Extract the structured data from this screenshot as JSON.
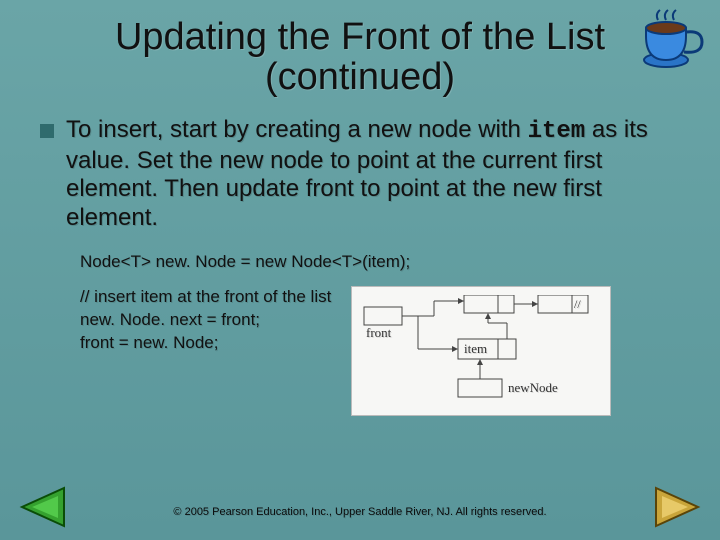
{
  "title": "Updating the Front of the List (continued)",
  "bullet_text_pre": "To insert, start by creating a new node with ",
  "bullet_text_mono": "item",
  "bullet_text_post": " as its value.  Set the new node to point at the current first element.  Then update front to point at the new first element.",
  "code": {
    "line1": "Node<T> new. Node = new Node<T>(item);",
    "comment": "// insert item at the front of the list",
    "line2": "new. Node. next = front;",
    "line3": "front = new. Node;"
  },
  "diagram": {
    "front_label": "front",
    "item_label": "item",
    "newnode_label": "newNode",
    "slash": "//"
  },
  "footer": "© 2005 Pearson Education, Inc., Upper Saddle River, NJ.  All rights reserved."
}
